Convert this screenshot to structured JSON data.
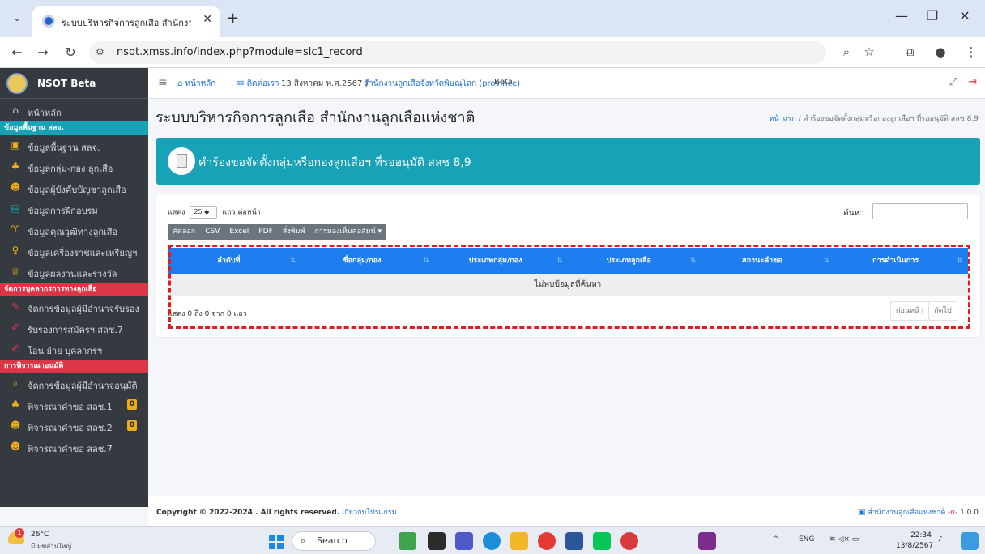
{
  "browser": {
    "tab_title": "ระบบบริหารกิจการลูกเสือ สำนักงานลู",
    "url_site_icon": "site-settings-icon",
    "url": "nsot.xmss.info/index.php?module=slc1_record"
  },
  "sidebar": {
    "brand": "NSOT Beta",
    "home": "หน้าหลัก",
    "section1": "ข้อมูลพื้นฐาน สลจ.",
    "items1": [
      {
        "label": "ข้อมูลพื้นฐาน สลจ.",
        "icon": "boxes-icon",
        "color": "#f0ad1a"
      },
      {
        "label": "ข้อมูลกลุ่ม-กอง ลูกเสือ",
        "icon": "sitemap-icon",
        "color": "#f0ad1a"
      },
      {
        "label": "ข้อมูลผู้บังคับบัญชาลูกเสือ",
        "icon": "users-icon",
        "color": "#f0ad1a"
      },
      {
        "label": "ข้อมูลการฝึกอบรม",
        "icon": "id-card-icon",
        "color": "#17a2b8"
      },
      {
        "label": "ข้อมูลคุณวุฒิทางลูกเสือ",
        "icon": "award-icon",
        "color": "#f0ad1a"
      },
      {
        "label": "ข้อมูลเครื่องราชและเหรียญฯ",
        "icon": "medal-icon",
        "color": "#f0ad1a"
      },
      {
        "label": "ข้อมูลผลงานและรางวัล",
        "icon": "trophy-icon",
        "color": "#f0ad1a"
      }
    ],
    "section2": "จัดการบุคลากรการทางลูกเสือ",
    "items2": [
      {
        "label": "จัดการข้อมูลผู้มีอำนาจรับรอง",
        "icon": "user-pen-icon",
        "color": "#dc3545"
      },
      {
        "label": "รับรองการสมัครฯ สลช.7",
        "icon": "edit-icon",
        "color": "#dc3545"
      },
      {
        "label": "โอน ย้าย บุคลากรฯ",
        "icon": "edit-icon",
        "color": "#dc3545"
      }
    ],
    "section3": "การพิจารณาอนุมัติ",
    "items3": [
      {
        "label": "จัดการข้อมูลผู้มีอำนาจอนุมัติ",
        "icon": "search-icon",
        "color": "#f0ad1a"
      },
      {
        "label": "พิจารณาคำขอ สลช.1",
        "icon": "sitemap-icon",
        "color": "#f0ad1a",
        "badge": "0"
      },
      {
        "label": "พิจารณาคำขอ สลช.2",
        "icon": "users-icon",
        "color": "#f0ad1a",
        "badge": "0"
      },
      {
        "label": "พิจารณาคำขอ สลช.7",
        "icon": "users-icon",
        "color": "#f0ad1a"
      }
    ]
  },
  "topnav": {
    "home": "หน้าหลัก",
    "contact": "ติดต่อเรา",
    "date": "13 สิงหาคม พ.ศ.2567 |",
    "agency": "สำนักงานลูกเสือจังหวัดพิษณุโลก (province)",
    "agency_tail": "Beta"
  },
  "page": {
    "title": "ระบบบริหารกิจการลูกเสือ สำนักงานลูกเสือแห่งชาติ",
    "breadcrumb_home": "หน้าแรก",
    "breadcrumb_sep": " / ",
    "breadcrumb_current": "คำร้องขอจัดตั้งกลุ่มหรือกองลูกเสือฯ ที่รออนุมัติ สลช 8,9",
    "banner_title": "คำร้องขอจัดตั้งกลุ่มหรือกองลูกเสือฯ ที่รออนุมัติ สลช 8,9"
  },
  "table": {
    "show_label": "แสดง",
    "page_length": "25",
    "per_page_label": "แถว ต่อหน้า",
    "search_label": "ค้นหา :",
    "buttons": [
      "คัดลอก",
      "CSV",
      "Excel",
      "PDF",
      "สั่งพิมพ์",
      "การมองเห็นคอลัมน์ ▾"
    ],
    "columns": [
      "ลำดับที่",
      "ชื่อกลุ่ม/กอง",
      "ประเภทกลุ่ม/กอง",
      "ประเภทลูกเสือ",
      "สถานะคำขอ",
      "การดำเนินการ"
    ],
    "empty": "ไม่พบข้อมูลที่ค้นหา",
    "info": "แสดง 0 ถึง 0 จาก 0 แถว",
    "prev": "ก่อนหน้า",
    "next": "ถัดไป"
  },
  "footer": {
    "copyright": "Copyright © 2022-2024 . All rights reserved.",
    "about": "เกี่ยวกับโปรแกรม",
    "org": "สำนักงานลูกเสือแห่งชาติ",
    "version": "1.0.0"
  },
  "taskbar": {
    "temp": "26°C",
    "condition": "มีเมฆส่วนใหญ่",
    "weather_badge": "1",
    "search": "Search",
    "lang": "ENG",
    "time": "22:34",
    "date": "13/8/2567"
  }
}
